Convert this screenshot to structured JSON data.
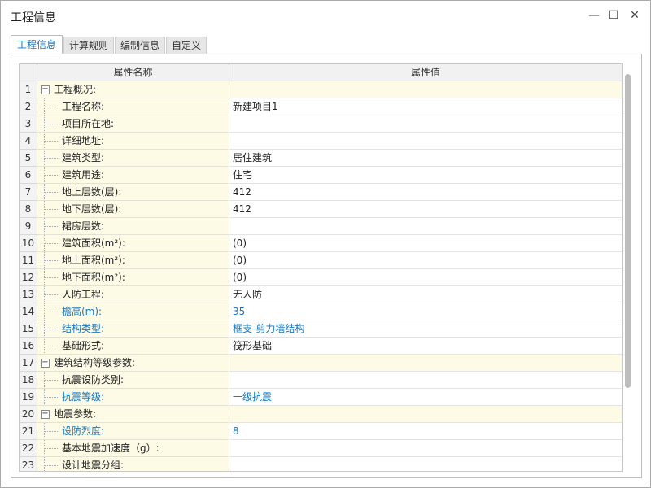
{
  "window": {
    "title": "工程信息",
    "minimize": "—",
    "maximize": "☐",
    "close": "✕"
  },
  "tabs": [
    {
      "label": "工程信息",
      "active": true
    },
    {
      "label": "计算规则",
      "active": false
    },
    {
      "label": "编制信息",
      "active": false
    },
    {
      "label": "自定义",
      "active": false
    }
  ],
  "table": {
    "headers": {
      "name": "属性名称",
      "value": "属性值"
    },
    "toggle_symbol": "−",
    "rows": [
      {
        "num": "1",
        "name": "工程概况:",
        "value": "",
        "group": true
      },
      {
        "num": "2",
        "name": "工程名称:",
        "value": "新建项目1"
      },
      {
        "num": "3",
        "name": "项目所在地:",
        "value": ""
      },
      {
        "num": "4",
        "name": "详细地址:",
        "value": ""
      },
      {
        "num": "5",
        "name": "建筑类型:",
        "value": "居住建筑"
      },
      {
        "num": "6",
        "name": "建筑用途:",
        "value": "住宅"
      },
      {
        "num": "7",
        "name": "地上层数(层):",
        "value": "412"
      },
      {
        "num": "8",
        "name": "地下层数(层):",
        "value": "412"
      },
      {
        "num": "9",
        "name": "裙房层数:",
        "value": ""
      },
      {
        "num": "10",
        "name": "建筑面积(m²):",
        "value": "(0)"
      },
      {
        "num": "11",
        "name": "地上面积(m²):",
        "value": "(0)"
      },
      {
        "num": "12",
        "name": "地下面积(m²):",
        "value": "(0)"
      },
      {
        "num": "13",
        "name": "人防工程:",
        "value": "无人防"
      },
      {
        "num": "14",
        "name": "檐高(m):",
        "value": "35",
        "highlight": true
      },
      {
        "num": "15",
        "name": "结构类型:",
        "value": "框支-剪力墙结构",
        "highlight": true
      },
      {
        "num": "16",
        "name": "基础形式:",
        "value": "筏形基础"
      },
      {
        "num": "17",
        "name": "建筑结构等级参数:",
        "value": "",
        "group": true
      },
      {
        "num": "18",
        "name": "抗震设防类别:",
        "value": ""
      },
      {
        "num": "19",
        "name": "抗震等级:",
        "value": "一级抗震",
        "highlight": true
      },
      {
        "num": "20",
        "name": "地震参数:",
        "value": "",
        "group": true
      },
      {
        "num": "21",
        "name": "设防烈度:",
        "value": "8",
        "highlight": true
      },
      {
        "num": "22",
        "name": "基本地震加速度（g）:",
        "value": ""
      },
      {
        "num": "23",
        "name": "设计地震分组:",
        "value": ""
      }
    ]
  },
  "colors": {
    "accent": "#1a78c2",
    "name_cell_bg": "#fdfae6"
  }
}
